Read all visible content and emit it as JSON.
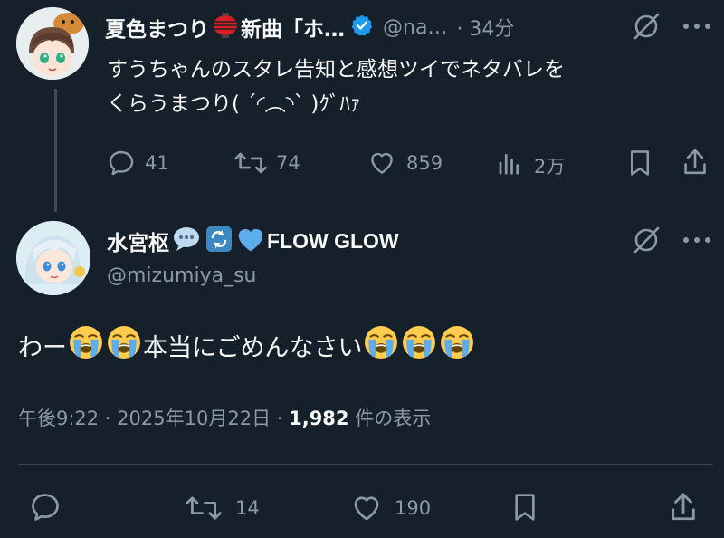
{
  "parent_tweet": {
    "display_name": "夏色まつり",
    "name_suffix": "新曲「ホ…",
    "handle": "@na…",
    "time": "· 34分",
    "text_line1": "すうちゃんのスタレ告知と感想ツイでネタバレを",
    "text_line2": "くらうまつり( ´◜︵◝` )ｸﾞﾊｧ",
    "replies": "41",
    "retweets": "74",
    "likes": "859",
    "views": "2万"
  },
  "main_tweet": {
    "display_name": "水宮枢",
    "name_tail": "FLOW GLOW",
    "handle": "@mizumiya_su",
    "text_before": "わー",
    "text_middle": "本当にごめんなさい",
    "timestamp": "午後9:22 · 2025年10月22日 · ",
    "view_count": "1,982",
    "view_label": " 件の表示",
    "retweets": "14",
    "likes": "190"
  },
  "colors": {
    "background": "#15202b",
    "text": "#f7f9f9",
    "muted": "#8b98a5",
    "verified": "#1d9bf0",
    "divider": "#38444d"
  },
  "icons": {
    "verified": "verified-badge-icon",
    "grok": "grok-icon",
    "more": "more-icon",
    "reply": "reply-icon",
    "retweet": "retweet-icon",
    "like": "heart-icon",
    "views": "views-chart-icon",
    "bookmark": "bookmark-icon",
    "share": "share-icon"
  }
}
